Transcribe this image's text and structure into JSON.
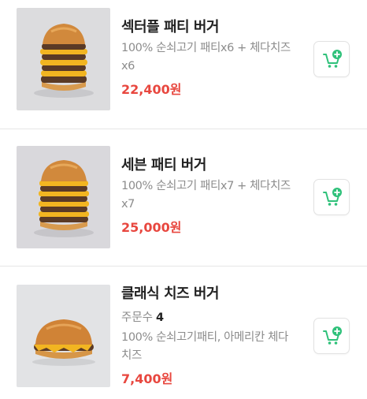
{
  "items": [
    {
      "name": "섹터플 패티 버거",
      "description": "100% 순쇠고기 패티x6 + 체다치즈x6",
      "price": "22,400원",
      "cart_icon": "add-to-cart-icon"
    },
    {
      "name": "세븐 패티 버거",
      "description": "100% 순쇠고기 패티x7 + 체다치즈x7",
      "price": "25,000원",
      "cart_icon": "add-to-cart-icon"
    },
    {
      "name": "클래식 치즈 버거",
      "orders_label": "주문수",
      "orders_count": "4",
      "description": "100% 순쇠고기패티, 아메리칸 체다 치즈",
      "price": "7,400원",
      "cart_icon": "add-to-cart-icon"
    }
  ],
  "colors": {
    "price": "#e8473f",
    "cart_accent": "#2fc17a",
    "divider": "#e6e6e6"
  }
}
